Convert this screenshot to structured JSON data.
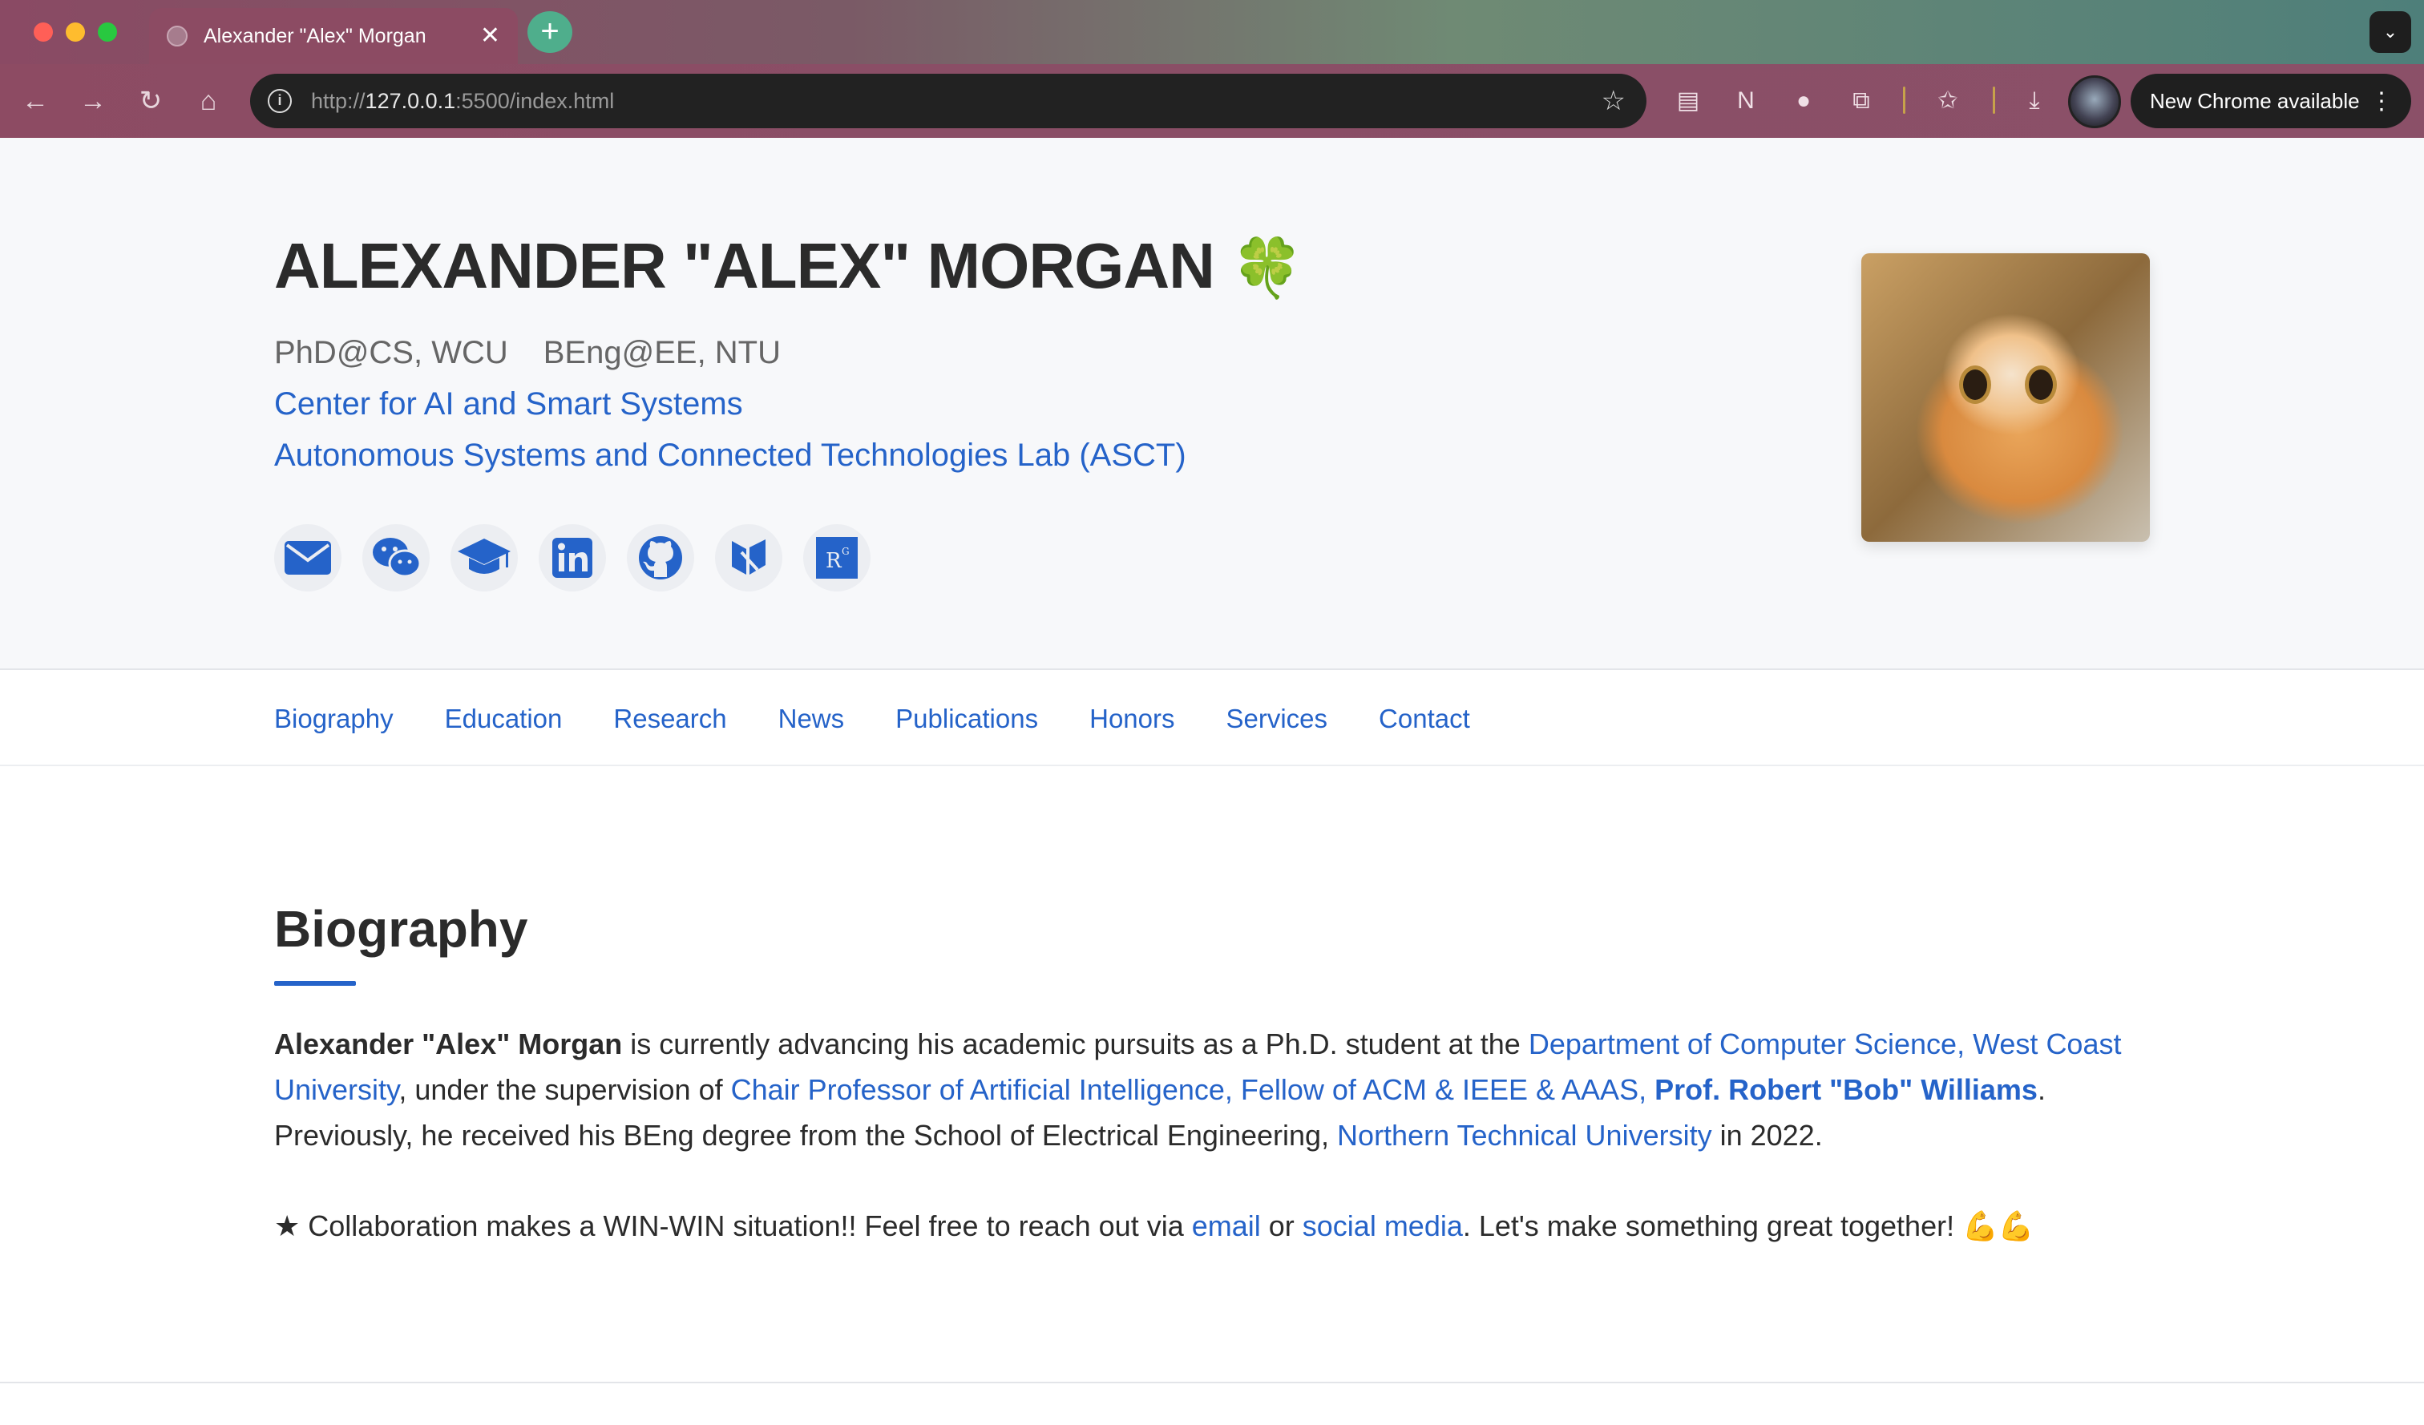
{
  "browser": {
    "tab_title": "Alexander \"Alex\" Morgan",
    "url_scheme": "http://",
    "url_host": "127.0.0.1",
    "url_rest": ":5500/index.html",
    "new_chrome": "New Chrome available"
  },
  "header": {
    "name": "ALEXANDER \"ALEX\" MORGAN",
    "name_emoji": "🍀",
    "degree_1": "PhD@CS, WCU",
    "degree_2": "BEng@EE, NTU",
    "affiliation_1": "Center for AI and Smart Systems",
    "affiliation_2": "Autonomous Systems and Connected Technologies Lab (ASCT)",
    "social_icons": [
      "email-icon",
      "wechat-icon",
      "google-scholar-icon",
      "linkedin-icon",
      "github-icon",
      "orcid-icon",
      "researchgate-icon"
    ]
  },
  "nav": {
    "items": [
      "Biography",
      "Education",
      "Research",
      "News",
      "Publications",
      "Honors",
      "Services",
      "Contact"
    ]
  },
  "biography": {
    "heading": "Biography",
    "name_bold": "Alexander \"Alex\" Morgan",
    "text_1": " is currently advancing his academic pursuits as a Ph.D. student at the ",
    "link_dept": "Department of Computer Science, West Coast University",
    "text_2": ", under the supervision of ",
    "link_prof_title": "Chair Professor of Artificial Intelligence, Fellow of ACM & IEEE & AAAS, ",
    "link_prof_name": "Prof. Robert \"Bob\" Williams",
    "text_3": ". Previously, he received his BEng degree from the School of Electrical Engineering, ",
    "link_univ": "Northern Technical University",
    "text_4": " in 2022.",
    "collab_1": "★ Collaboration makes a WIN-WIN situation!! Feel free to reach out via ",
    "collab_email": "email",
    "collab_or": " or ",
    "collab_social": "social media",
    "collab_2": ". Let's make something great together! 💪💪"
  },
  "colors": {
    "accent": "#2563c9",
    "text": "#2b2b2b",
    "hero_bg": "#f7f8fa"
  }
}
